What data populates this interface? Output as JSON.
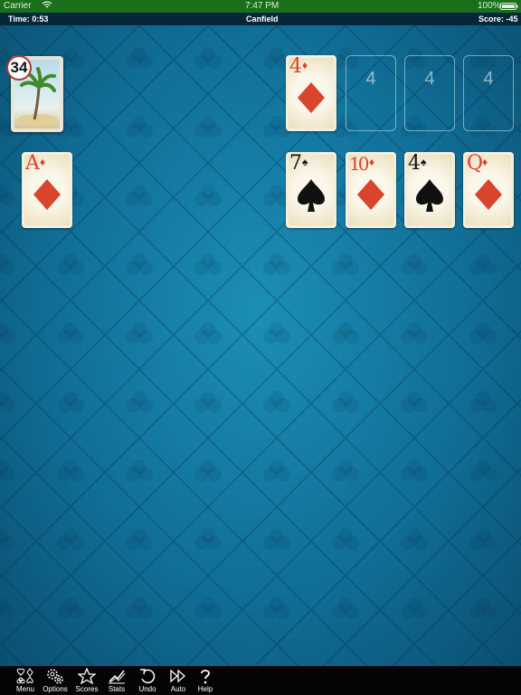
{
  "status_bar": {
    "carrier": "Carrier",
    "time": "7:47 PM",
    "battery": "100%"
  },
  "top_bar": {
    "time_label": "Time: 0:53",
    "game_title": "Canfield",
    "score_label": "Score: -45"
  },
  "stock": {
    "count": "34",
    "image": "palm-tree-beach"
  },
  "waste": {
    "rank": "A",
    "suit": "♦",
    "color": "red"
  },
  "foundation_top": {
    "rank": "4",
    "suit": "♦",
    "color": "red"
  },
  "foundation_slots": [
    "4",
    "4",
    "4"
  ],
  "tableau": [
    {
      "rank": "7",
      "suit": "♠",
      "color": "black"
    },
    {
      "rank": "10",
      "suit": "♦",
      "color": "red"
    },
    {
      "rank": "4",
      "suit": "♠",
      "color": "black"
    },
    {
      "rank": "Q",
      "suit": "♦",
      "color": "red"
    }
  ],
  "toolbar": [
    {
      "label": "Menu",
      "icon": "suits-icon"
    },
    {
      "label": "Options",
      "icon": "gears-icon"
    },
    {
      "label": "Scores",
      "icon": "star-icon"
    },
    {
      "label": "Stats",
      "icon": "chart-icon"
    },
    {
      "label": "Undo",
      "icon": "undo-icon"
    },
    {
      "label": "Auto",
      "icon": "fast-forward-icon"
    },
    {
      "label": "Help",
      "icon": "question-icon"
    }
  ],
  "colors": {
    "felt": "#116f98",
    "status_bar": "#1a6f1b",
    "top_bar": "#06273a",
    "red_suit": "#d9442c"
  }
}
